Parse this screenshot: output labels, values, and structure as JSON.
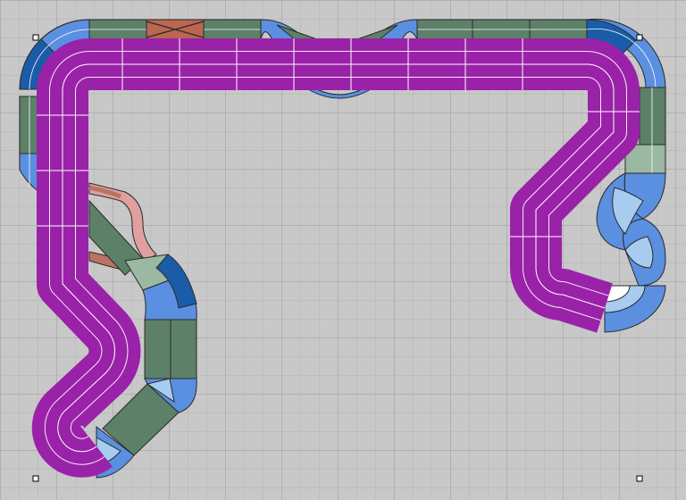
{
  "view": {
    "background": "#c8c8c8",
    "grid_minor_color": "#b4b4b4",
    "grid_major_color": "#9a9a9a",
    "grid_major_every": 3
  },
  "track_colors": {
    "main_loop": "#9a22a8",
    "straight_dark_green": "#5d8068",
    "straight_light_green": "#9ab8a2",
    "curve_blue": "#5b8fe0",
    "curve_dark_blue": "#1a5ca8",
    "curve_light_blue": "#a8ccf0",
    "connector_salmon": "#e0a0a0",
    "connector_brick": "#bb7262",
    "crossover": "#bb6650",
    "lane_line": "#ffffff",
    "edge_line": "#2a2a2a"
  },
  "track_pieces": [
    {
      "name": "main-loop-track",
      "color_key": "main_loop",
      "lanes": 4
    },
    {
      "name": "top-outer-straights",
      "color_key": "straight_dark_green",
      "lanes": 2
    },
    {
      "name": "crossover-piece",
      "color_key": "crossover",
      "lanes": 2
    },
    {
      "name": "branch-straights",
      "color_key": "straight_dark_green",
      "lanes": 2
    },
    {
      "name": "branch-connectors",
      "color_key": "connector_salmon",
      "lanes": 2
    },
    {
      "name": "outer-curves",
      "color_key": "curve_blue",
      "lanes": 2
    },
    {
      "name": "inner-curves",
      "color_key": "curve_light_blue",
      "lanes": 2
    }
  ],
  "selection_handles": 4
}
